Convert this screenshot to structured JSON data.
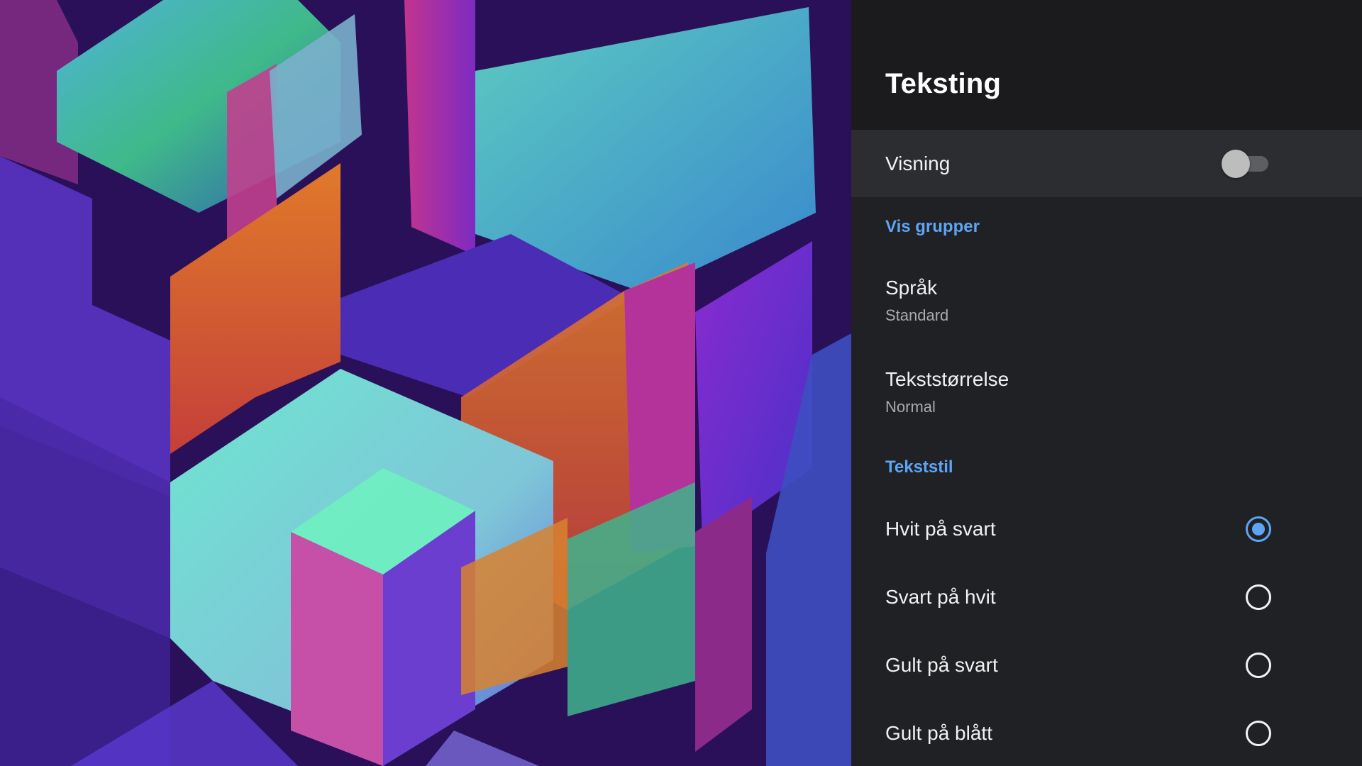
{
  "panel": {
    "title": "Teksting",
    "display_toggle": {
      "label": "Visning",
      "on": false
    },
    "sections": {
      "show_groups": "Vis grupper",
      "text_style": "Tekststil"
    },
    "items": {
      "language": {
        "title": "Språk",
        "value": "Standard"
      },
      "text_size": {
        "title": "Tekststørrelse",
        "value": "Normal"
      }
    },
    "styles": [
      {
        "label": "Hvit på svart",
        "selected": true
      },
      {
        "label": "Svart på hvit",
        "selected": false
      },
      {
        "label": "Gult på svart",
        "selected": false
      },
      {
        "label": "Gult på blått",
        "selected": false
      }
    ]
  },
  "colors": {
    "accent": "#5ea4f4",
    "panel_bg": "#202124",
    "header_bg": "#1b1b1d",
    "focused_row_bg": "#2c2d30"
  }
}
